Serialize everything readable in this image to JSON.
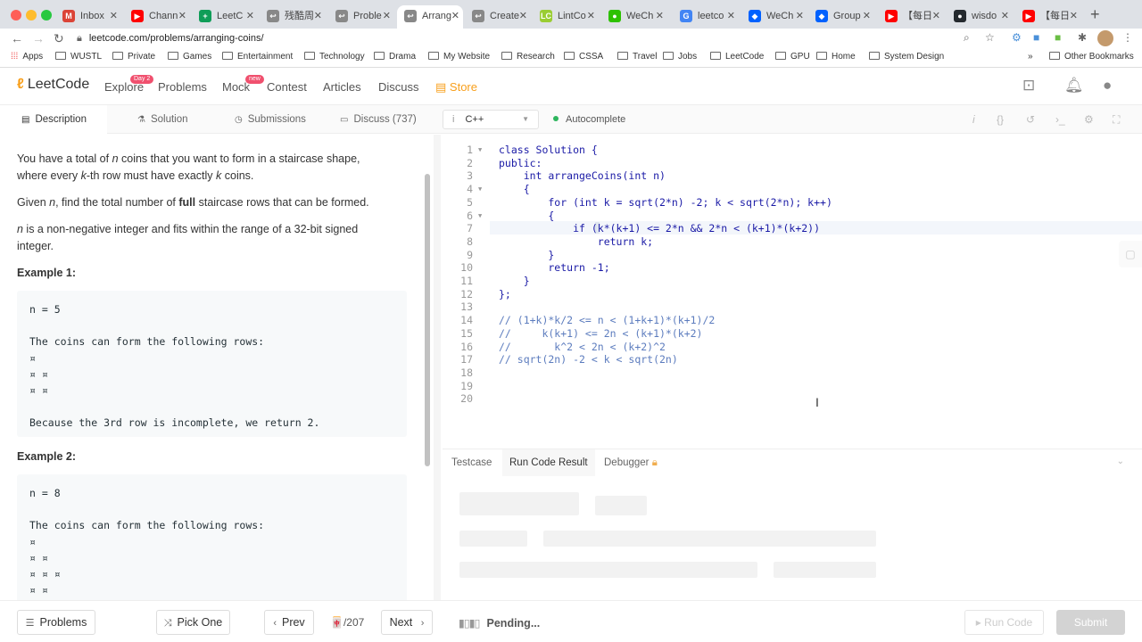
{
  "browser": {
    "tabs": [
      {
        "label": "Inbox",
        "fav": "M",
        "color": "#db4437"
      },
      {
        "label": "Chann",
        "fav": "▶",
        "color": "#ff0000"
      },
      {
        "label": "LeetC",
        "fav": "+",
        "color": "#0f9d58"
      },
      {
        "label": "残酷周",
        "fav": "↩",
        "color": "#888888"
      },
      {
        "label": "Proble",
        "fav": "↩",
        "color": "#888888"
      },
      {
        "label": "Arrang",
        "fav": "↩",
        "color": "#888888"
      },
      {
        "label": "Create",
        "fav": "↩",
        "color": "#888888"
      },
      {
        "label": "LintCo",
        "fav": "LC",
        "color": "#9acd32"
      },
      {
        "label": "WeCh",
        "fav": "●",
        "color": "#2dc100"
      },
      {
        "label": "leetco",
        "fav": "G",
        "color": "#4285f4"
      },
      {
        "label": "WeCh",
        "fav": "◆",
        "color": "#0061fe"
      },
      {
        "label": "Group",
        "fav": "◆",
        "color": "#0061fe"
      },
      {
        "label": "【每日",
        "fav": "▶",
        "color": "#ff0000"
      },
      {
        "label": "wisdo",
        "fav": "●",
        "color": "#24292e"
      },
      {
        "label": "【每日",
        "fav": "▶",
        "color": "#ff0000"
      }
    ],
    "url": "leetcode.com/problems/arranging-coins/",
    "bookmarks": [
      "Apps",
      "WUSTL",
      "Private",
      "Games",
      "Entertainment",
      "Technology",
      "Drama",
      "My Website",
      "Research",
      "CSSA",
      "Travel",
      "Jobs",
      "LeetCode",
      "GPU",
      "Home",
      "System Design"
    ],
    "other_bookmarks": "Other Bookmarks",
    "more": "»"
  },
  "nav": {
    "logo": "LeetCode",
    "explore": "Explore",
    "explore_badge": "Day 2",
    "problems": "Problems",
    "mock": "Mock",
    "mock_badge": "new",
    "contest": "Contest",
    "articles": "Articles",
    "discuss": "Discuss",
    "store": "Store"
  },
  "lctabs": {
    "description": "Description",
    "solution": "Solution",
    "submissions": "Submissions",
    "discuss": "Discuss (737)",
    "language": "C++",
    "autocomplete": "Autocomplete"
  },
  "description": {
    "p1a": "You have a total of ",
    "p1n": "n",
    "p1b": " coins that you want to form in a staircase shape,",
    "p1c": "where every ",
    "p1k": "k",
    "p1d": "-th row must have exactly ",
    "p1k2": "k",
    "p1e": " coins.",
    "p2a": "Given ",
    "p2n": "n",
    "p2b": ", find the total number of ",
    "p2full": "full",
    "p2c": " staircase rows that can be formed.",
    "p3n": "n",
    "p3a": " is a non-negative integer and fits within the range of a 32-bit signed",
    "p3b": "integer.",
    "ex1_title": "Example 1:",
    "ex1": [
      "n = 5",
      "",
      "The coins can form the following rows:",
      "¤",
      "¤ ¤",
      "¤ ¤",
      "",
      "Because the 3rd row is incomplete, we return 2."
    ],
    "ex2_title": "Example 2:",
    "ex2": [
      "n = 8",
      "",
      "The coins can form the following rows:",
      "¤",
      "¤ ¤",
      "¤ ¤ ¤",
      "¤ ¤"
    ]
  },
  "code": {
    "lines": [
      "class Solution {",
      "public:",
      "    int arrangeCoins(int n)",
      "    {",
      "        for (int k = sqrt(2*n) -2; k < sqrt(2*n); k++)",
      "        {",
      "            if (k*(k+1) <= 2*n && 2*n < (k+1)*(k+2))",
      "                return k;",
      "        }",
      "        return -1;",
      "    }",
      "};",
      "",
      "// (1+k)*k/2 <= n < (1+k+1)*(k+1)/2",
      "//     k(k+1) <= 2n < (k+1)*(k+2)",
      "//       k^2 < 2n < (k+2)^2",
      "// sqrt(2n) -2 < k < sqrt(2n)",
      "",
      "",
      ""
    ]
  },
  "console": {
    "testcase": "Testcase",
    "result": "Run Code Result",
    "debugger": "Debugger"
  },
  "footer": {
    "problems": "Problems",
    "pick_one": "Pick One",
    "prev": "Prev",
    "page": "🀄/207",
    "next": "Next",
    "pending": "Pending...",
    "run_code": "Run Code",
    "submit": "Submit"
  }
}
